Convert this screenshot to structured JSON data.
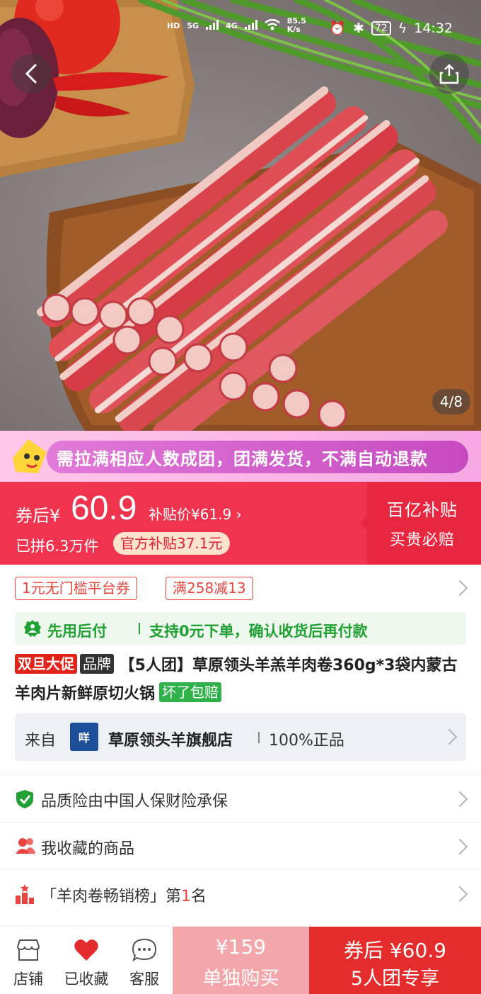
{
  "status_bar": {
    "net_labels": [
      "HD",
      "5G",
      "4G"
    ],
    "speed": "85.5",
    "speed_unit": "K/s",
    "battery": "72",
    "time": "14:32"
  },
  "hero": {
    "image_counter": "4/8"
  },
  "group_banner": {
    "text": "需拉满相应人数成团，团满发货，不满自动退款"
  },
  "price": {
    "after_coupon_label": "券后",
    "currency": "¥",
    "amount": "60.9",
    "subsidy_price": "补贴价¥61.9 ›",
    "sold": "已拼6.3万件",
    "official_subsidy": "官方补贴37.1元",
    "side_title": "百亿补贴",
    "side_sub": "买贵必赔"
  },
  "coupons": [
    "1元无门槛平台券",
    "满258减13"
  ],
  "paylater": {
    "title": "先用后付",
    "desc": "支持0元下单，确认收货后再付款"
  },
  "product": {
    "promo_tag": "双旦大促",
    "brand_tag": "品牌",
    "title": "【5人团】草原领头羊羔羊肉卷360g*3袋内蒙古羊肉片新鲜原切火锅",
    "guarantee_tag": "坏了包赔"
  },
  "store": {
    "from_label": "来自",
    "logo_text": "咩",
    "name": "草原领头羊旗舰店",
    "authentic": "100%正品"
  },
  "rows": {
    "insurance": "品质险由中国人保财险承保",
    "favorites": "我收藏的商品",
    "ranking_prefix": "「羊肉卷畅销榜」第",
    "ranking_num": "1",
    "ranking_suffix": "名"
  },
  "bottom": {
    "shop": "店铺",
    "favorited": "已收藏",
    "service": "客服",
    "single_price": "¥159",
    "single_label": "单独购买",
    "group_price": "券后 ¥60.9",
    "group_label": "5人团专享"
  },
  "colors": {
    "price_red": "#f0344f",
    "panel_red": "#e6273f",
    "buy_red": "#e42c2c",
    "single_pink": "#f3a7aa",
    "paylater_green": "#21a133"
  }
}
